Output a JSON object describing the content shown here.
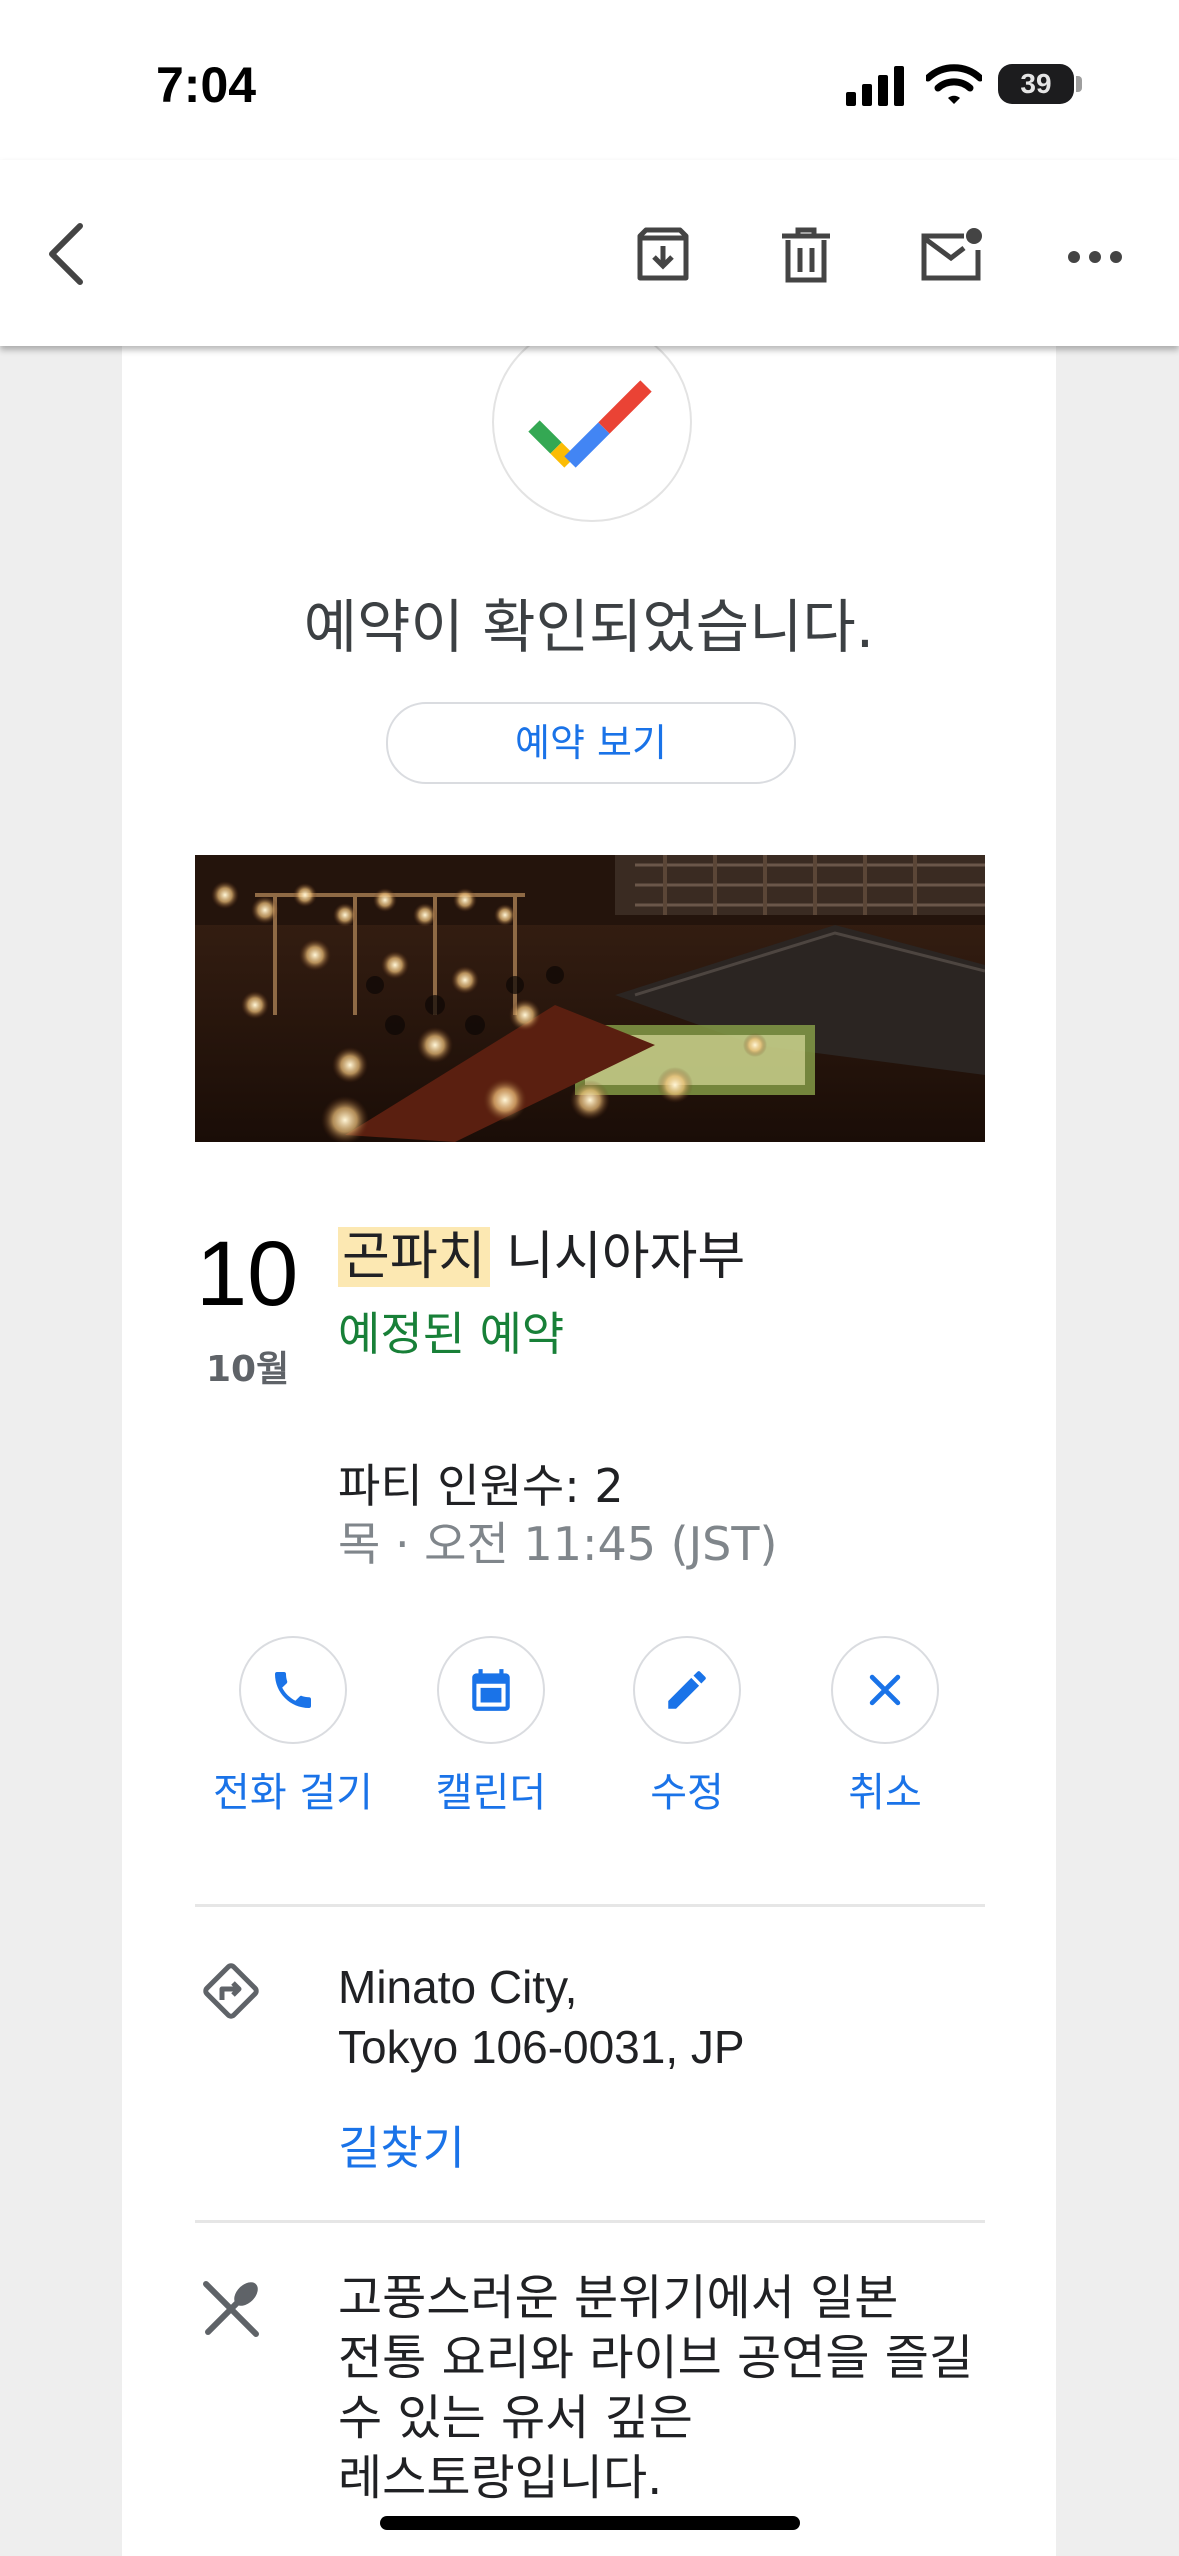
{
  "status_bar": {
    "time": "7:04",
    "battery": "39"
  },
  "toolbar": {
    "back_icon": "chevron-left-icon",
    "archive_icon": "archive-icon",
    "delete_icon": "trash-icon",
    "unread_icon": "mark-unread-icon",
    "more_icon": "more-horizontal-icon"
  },
  "confirmation": {
    "title": "예약이 확인되었습니다.",
    "view_button": "예약 보기"
  },
  "reservation": {
    "day": "10",
    "month": "10월",
    "name_highlight": "곤파치",
    "name_rest": " 니시아자부",
    "status": "예정된 예약",
    "party": "파티 인원수: 2",
    "datetime": "목 · 오전 11:45 (JST)"
  },
  "actions": [
    {
      "label": "전화 걸기",
      "icon": "phone-icon"
    },
    {
      "label": "캘린더",
      "icon": "calendar-icon"
    },
    {
      "label": "수정",
      "icon": "pencil-icon"
    },
    {
      "label": "취소",
      "icon": "close-icon"
    }
  ],
  "address": {
    "line1": "Minato City,",
    "line2": "Tokyo 106-0031, JP",
    "directions": "길찾기"
  },
  "description": "고풍스러운 분위기에서 일본 전통 요리와 라이브 공연을 즐길 수 있는 유서 깊은 레스토랑입니다.",
  "colors": {
    "accent": "#1a73e8",
    "status_green": "#188038",
    "highlight": "#fce8b2"
  }
}
